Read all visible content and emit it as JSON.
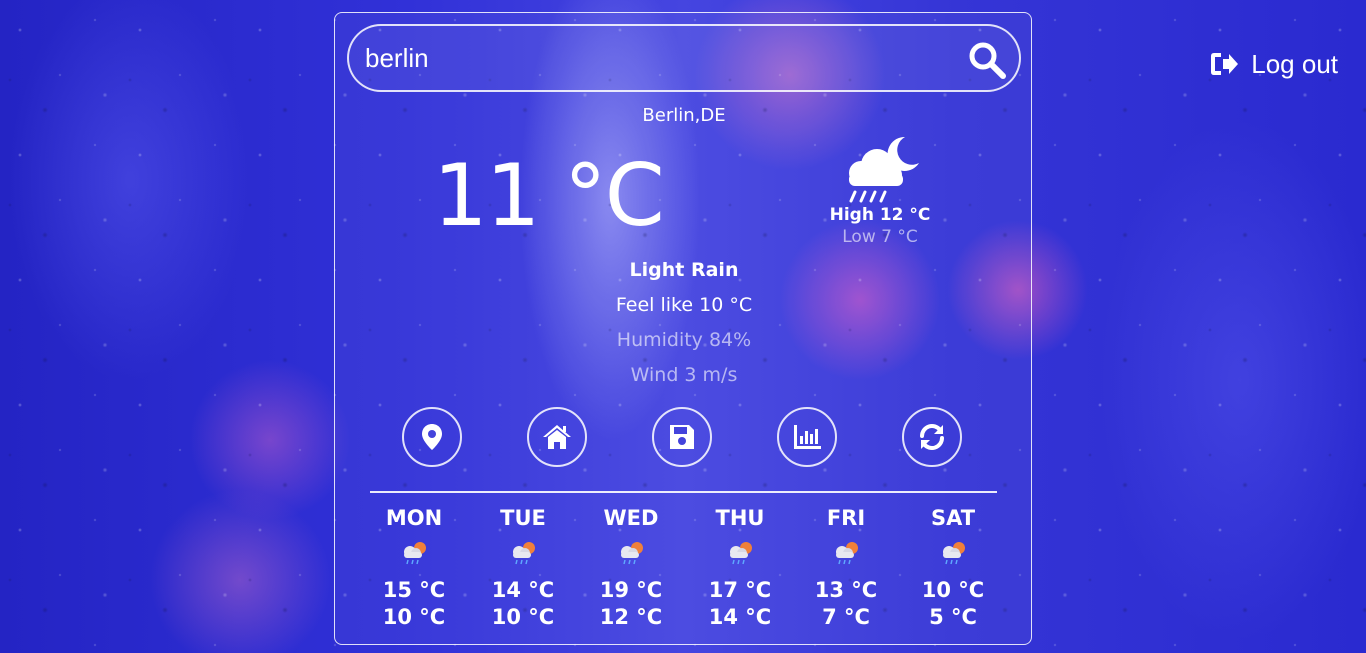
{
  "search": {
    "value": "berlin",
    "icon": "search-icon"
  },
  "current": {
    "location": "Berlin,DE",
    "temp": "11 °C",
    "icon": "cloud-rain-moon-icon",
    "high": "High 12 °C",
    "low": "Low 7 °C",
    "condition": "Light Rain",
    "feels_like": "Feel like 10 °C",
    "humidity": "Humidity 84%",
    "wind": "Wind 3 m/s"
  },
  "actions": [
    {
      "icon": "map-marker-icon"
    },
    {
      "icon": "home-icon"
    },
    {
      "icon": "save-icon"
    },
    {
      "icon": "bar-chart-icon"
    },
    {
      "icon": "refresh-icon"
    }
  ],
  "forecast": [
    {
      "day": "MON",
      "high": "15 °C",
      "low": "10 °C",
      "icon": "cloud-sun-rain-icon"
    },
    {
      "day": "TUE",
      "high": "14 °C",
      "low": "10 °C",
      "icon": "cloud-sun-rain-icon"
    },
    {
      "day": "WED",
      "high": "19 °C",
      "low": "12 °C",
      "icon": "cloud-sun-rain-icon"
    },
    {
      "day": "THU",
      "high": "17 °C",
      "low": "14 °C",
      "icon": "cloud-sun-rain-icon"
    },
    {
      "day": "FRI",
      "high": "13 °C",
      "low": "7 °C",
      "icon": "cloud-sun-rain-icon"
    },
    {
      "day": "SAT",
      "high": "10 °C",
      "low": "5 °C",
      "icon": "cloud-sun-rain-icon"
    }
  ],
  "header": {
    "logout_label": "Log out",
    "logout_icon": "sign-out-icon"
  },
  "colors": {
    "background": "#3535d6",
    "text": "#ffffff"
  }
}
